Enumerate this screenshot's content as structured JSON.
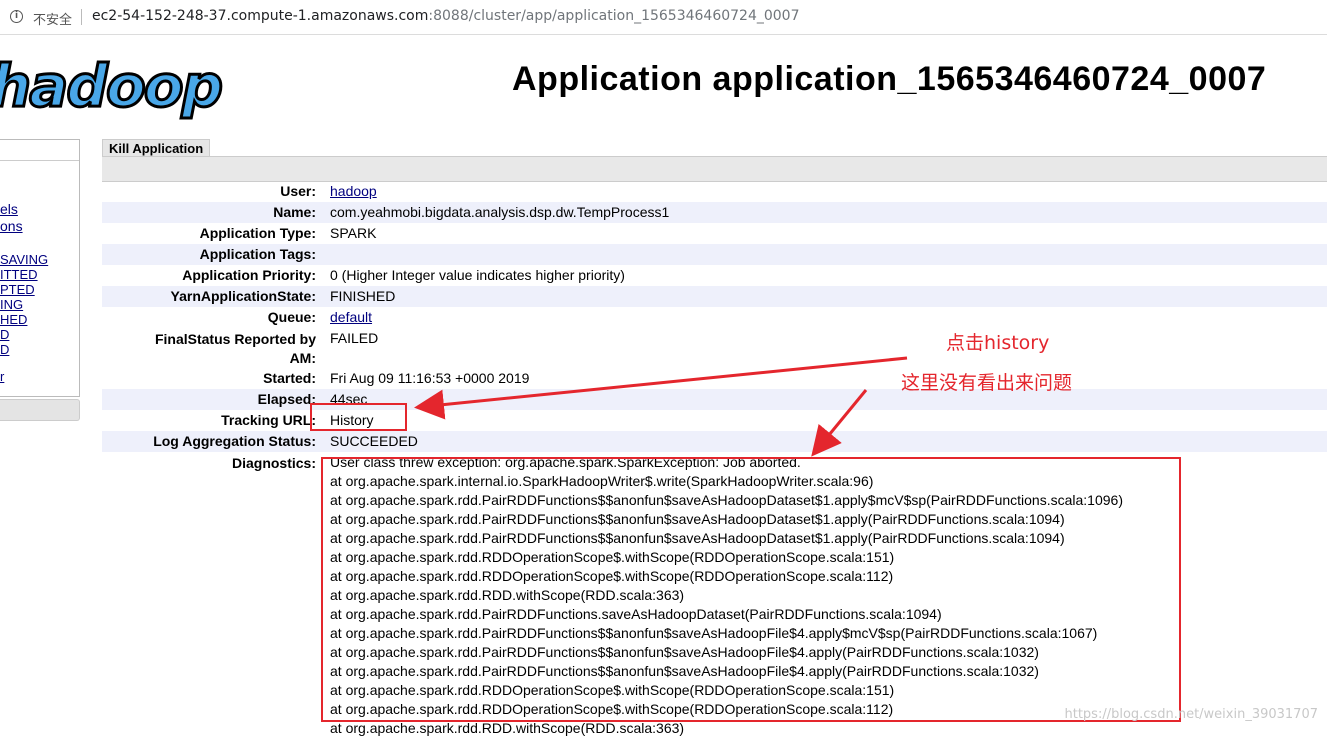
{
  "browser": {
    "security_label": "不安全",
    "url_host": "ec2-54-152-248-37.compute-1.amazonaws.com",
    "url_rest": ":8088/cluster/app/application_1565346460724_0007"
  },
  "logo_text": "hadoop",
  "page_title": "Application application_1565346460724_0007",
  "nav": {
    "items": [
      "els",
      "ons",
      "SAVING",
      "ITTED",
      "PTED",
      "ING",
      "HED",
      "D",
      "D",
      "r"
    ]
  },
  "kill_tab": "Kill Application",
  "details": [
    {
      "label": "User:",
      "value": "hadoop",
      "link": true
    },
    {
      "label": "Name:",
      "value": "com.yeahmobi.bigdata.analysis.dsp.dw.TempProcess1",
      "link": false
    },
    {
      "label": "Application Type:",
      "value": "SPARK",
      "link": false
    },
    {
      "label": "Application Tags:",
      "value": "",
      "link": false
    },
    {
      "label": "Application Priority:",
      "value": "0 (Higher Integer value indicates higher priority)",
      "link": false
    },
    {
      "label": "YarnApplicationState:",
      "value": "FINISHED",
      "link": false
    },
    {
      "label": "Queue:",
      "value": "default",
      "link": true
    }
  ],
  "final_status": {
    "label_line1": "FinalStatus Reported by",
    "label_line2": "AM:",
    "value": "FAILED"
  },
  "details2": [
    {
      "label": "Started:",
      "value": "Fri Aug 09 11:16:53 +0000 2019",
      "link": false
    },
    {
      "label": "Elapsed:",
      "value": "44sec",
      "link": false
    },
    {
      "label": "Tracking URL:",
      "value": "History",
      "link": false
    },
    {
      "label": "Log Aggregation Status:",
      "value": "SUCCEEDED",
      "link": false
    }
  ],
  "diagnostics_label": "Diagnostics:",
  "diagnostics": [
    "User class threw exception: org.apache.spark.SparkException: Job aborted.",
    "at org.apache.spark.internal.io.SparkHadoopWriter$.write(SparkHadoopWriter.scala:96)",
    "at org.apache.spark.rdd.PairRDDFunctions$$anonfun$saveAsHadoopDataset$1.apply$mcV$sp(PairRDDFunctions.scala:1096)",
    "at org.apache.spark.rdd.PairRDDFunctions$$anonfun$saveAsHadoopDataset$1.apply(PairRDDFunctions.scala:1094)",
    "at org.apache.spark.rdd.PairRDDFunctions$$anonfun$saveAsHadoopDataset$1.apply(PairRDDFunctions.scala:1094)",
    "at org.apache.spark.rdd.RDDOperationScope$.withScope(RDDOperationScope.scala:151)",
    "at org.apache.spark.rdd.RDDOperationScope$.withScope(RDDOperationScope.scala:112)",
    "at org.apache.spark.rdd.RDD.withScope(RDD.scala:363)",
    "at org.apache.spark.rdd.PairRDDFunctions.saveAsHadoopDataset(PairRDDFunctions.scala:1094)",
    "at org.apache.spark.rdd.PairRDDFunctions$$anonfun$saveAsHadoopFile$4.apply$mcV$sp(PairRDDFunctions.scala:1067)",
    "at org.apache.spark.rdd.PairRDDFunctions$$anonfun$saveAsHadoopFile$4.apply(PairRDDFunctions.scala:1032)",
    "at org.apache.spark.rdd.PairRDDFunctions$$anonfun$saveAsHadoopFile$4.apply(PairRDDFunctions.scala:1032)",
    "at org.apache.spark.rdd.RDDOperationScope$.withScope(RDDOperationScope.scala:151)",
    "at org.apache.spark.rdd.RDDOperationScope$.withScope(RDDOperationScope.scala:112)",
    "at org.apache.spark.rdd.RDD.withScope(RDD.scala:363)"
  ],
  "annotations": {
    "note1": "点击history",
    "note2": "这里没有看出来问题",
    "color": "#e4262d"
  },
  "watermark": "https://blog.csdn.net/weixin_39031707"
}
